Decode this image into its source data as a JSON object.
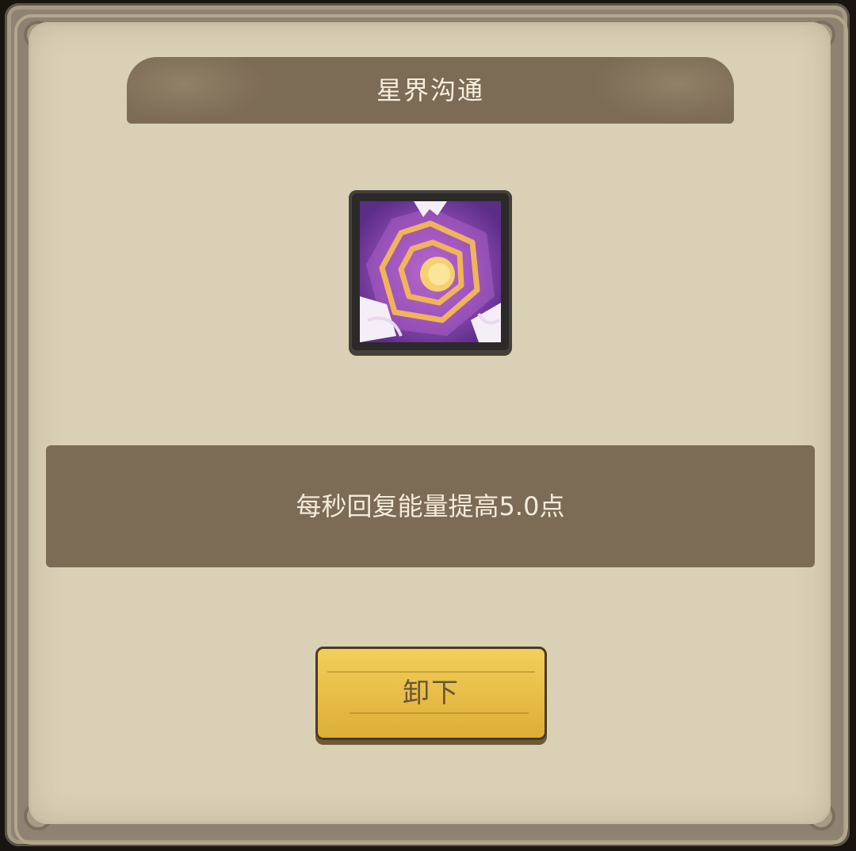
{
  "dialog": {
    "title": "星界沟通"
  },
  "skill": {
    "icon_name": "astral-vortex-icon",
    "description": "每秒回复能量提高5.0点"
  },
  "actions": {
    "unequip_label": "卸下"
  },
  "colors": {
    "panel_bg": "#d9d0b6",
    "banner_bg": "#7c6b55",
    "button_bg": "#e6bc46",
    "text_light": "#f6efde"
  }
}
